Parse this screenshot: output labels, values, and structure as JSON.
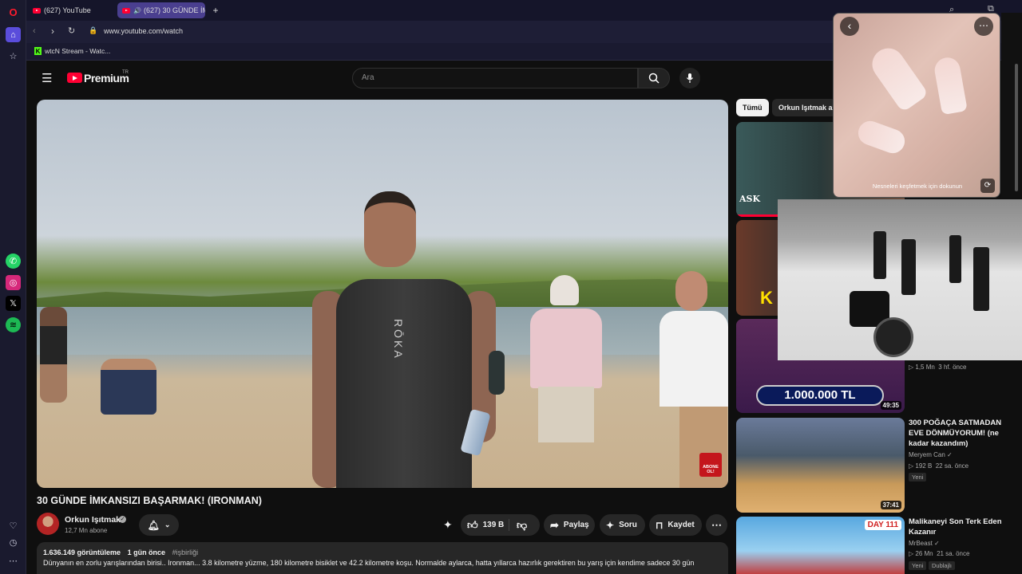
{
  "browser": {
    "tabs": [
      {
        "label": "(627) YouTube"
      },
      {
        "label": "(627) 30 GÜNDE İMKA..."
      }
    ],
    "new_tab_label": "+",
    "url": "www.youtube.com/watch",
    "bookmark": "wtcN Stream - Watc...",
    "ai_label": "AI"
  },
  "header": {
    "logo_text": "Premium",
    "logo_sup": "TR",
    "search_placeholder": "Ara"
  },
  "chips": [
    "Tümü",
    "Orkun Işıtmak a"
  ],
  "video": {
    "title": "30 GÜNDE İMKANSIZI BAŞARMAK! (IRONMAN)",
    "overlay_text": "ABONE OL!",
    "swimsuit_text": "RŌKA"
  },
  "channel": {
    "name": "Orkun Işıtmak",
    "subscribers": "12,7 Mn abone"
  },
  "actions": {
    "likes": "139 B",
    "share": "Paylaş",
    "ask": "Soru",
    "save": "Kaydet"
  },
  "description": {
    "views": "1.636.149 görüntüleme",
    "date": "1 gün önce",
    "tag": "#işbirliği",
    "text": "Dünyanın en zorlu yarışlarından birisi.. Ironman... 3.8 kilometre yüzme, 180 kilometre bisiklet ve 42.2 kilometre koşu. Normalde aylarca, hatta yıllarca hazırlık gerektiren bu yarış için kendime sadece 30 gün"
  },
  "popup": {
    "hint": "Nesneleri keşfetmek için dokunun"
  },
  "recommendations": [
    {
      "thumb_text": "ASK",
      "duration": ""
    },
    {
      "thumb_text": "K",
      "duration": ""
    },
    {
      "thumb_text": "1.000.000 TL",
      "duration": "49:35",
      "views": "1,5 Mn",
      "age": "3 hf. önce"
    },
    {
      "title": "300 POĞAÇA SATMADAN EVE DÖNMÜYORUM! (ne kadar kazandım)",
      "channel": "Meryem Can",
      "views": "192 B",
      "age": "22 sa. önce",
      "badge": "Yeni",
      "duration": "37:41"
    },
    {
      "title": "Malikaneyi Son Terk Eden Kazanır",
      "channel": "MrBeast",
      "views": "26 Mn",
      "age": "21 sa. önce",
      "badge": "Yeni",
      "badge2": "Dublajlı",
      "thumb_text": "DAY 111"
    }
  ],
  "colors": {
    "brand_red": "#ff0033",
    "background": "#0f0f0f",
    "pill": "#272727"
  }
}
